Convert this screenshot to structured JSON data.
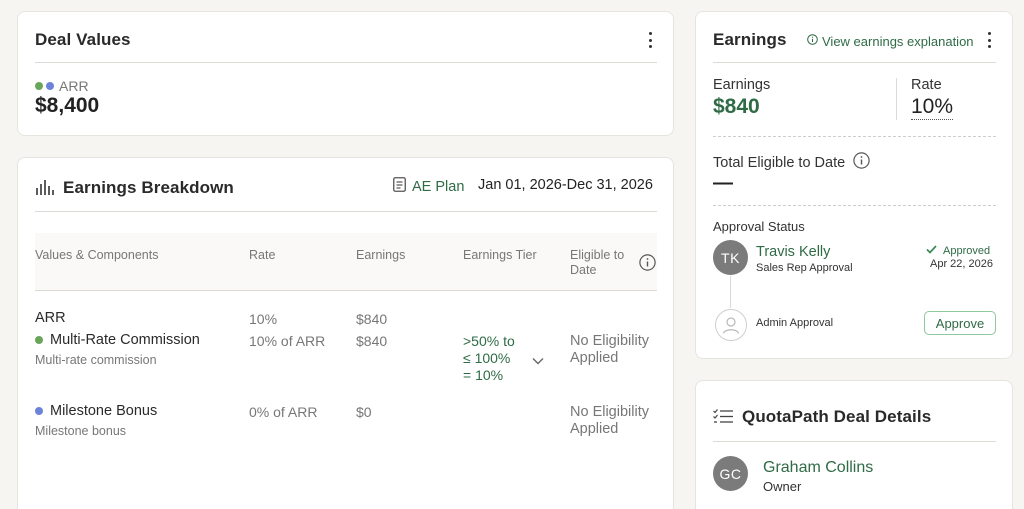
{
  "deal_values": {
    "title": "Deal Values",
    "metric_label": "ARR",
    "metric_value": "$8,400",
    "dot_colors": [
      "#6aa65a",
      "#6b84d9"
    ]
  },
  "earnings_breakdown": {
    "title": "Earnings Breakdown",
    "plan_label": "AE Plan",
    "date_range": "Jan 01, 2026-Dec 31, 2026",
    "columns": {
      "values": "Values & Components",
      "rate": "Rate",
      "earnings": "Earnings",
      "tier": "Earnings Tier",
      "eligible_line1": "Eligible to",
      "eligible_line2": "Date"
    },
    "group": {
      "name": "ARR",
      "rate": "10%",
      "earnings": "$840"
    },
    "rows": [
      {
        "name": "Multi-Rate Commission",
        "subtitle": "Multi-rate commission",
        "rate": "10% of ARR",
        "earnings": "$840",
        "tier_line1": ">50% to",
        "tier_line2": "≤ 100%",
        "tier_line3": "= 10%",
        "eligible_line1": "No Eligibility",
        "eligible_line2": "Applied",
        "color": "#6aa65a"
      },
      {
        "name": "Milestone Bonus",
        "subtitle": "Milestone bonus",
        "rate": "0% of ARR",
        "earnings": "$0",
        "eligible_line1": "No Eligibility",
        "eligible_line2": "Applied",
        "color": "#6b84d9"
      }
    ]
  },
  "earnings": {
    "title": "Earnings",
    "explanation_link": "View earnings explanation",
    "earnings_label": "Earnings",
    "earnings_value": "$840",
    "rate_label": "Rate",
    "rate_value": "10%",
    "total_eligible_label": "Total Eligible to Date",
    "total_eligible_value": "—",
    "approval_status_label": "Approval Status",
    "approvers": [
      {
        "initials": "TK",
        "name": "Travis Kelly",
        "role": "Sales Rep Approval",
        "status": "Approved",
        "date": "Apr 22, 2026"
      },
      {
        "role": "Admin Approval",
        "action": "Approve"
      }
    ]
  },
  "deal_details": {
    "title": "QuotaPath Deal Details",
    "owner_initials": "GC",
    "owner_name": "Graham Collins",
    "owner_role": "Owner"
  }
}
